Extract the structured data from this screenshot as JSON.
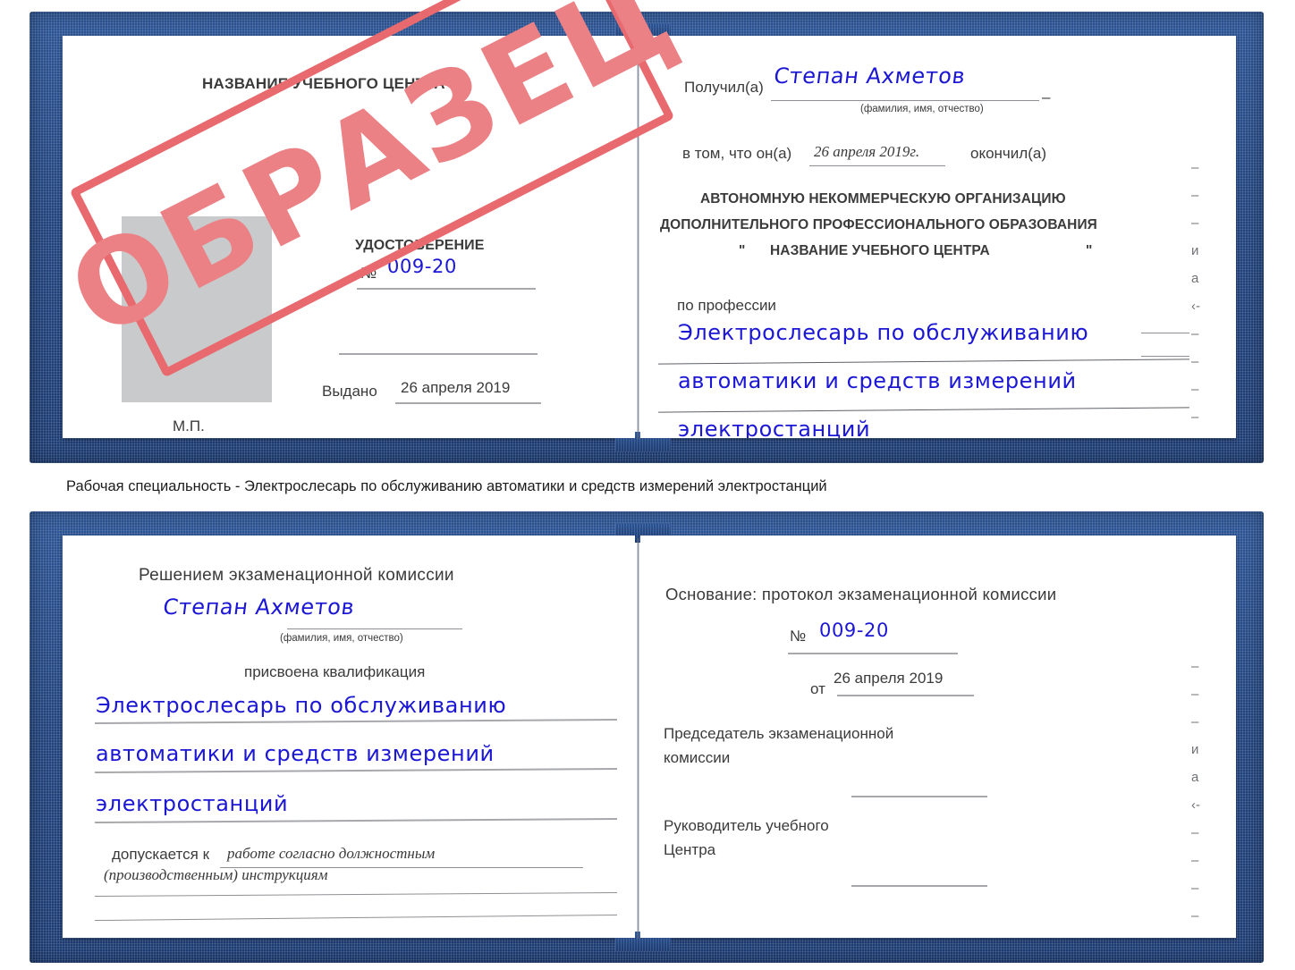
{
  "caption": {
    "text": "Рабочая специальность - Электрослесарь по обслуживанию автоматики и средств измерений электростанций"
  },
  "stamp": {
    "label": "ОБРАЗЕЦ",
    "color": "#e8696e",
    "text_color": "#eb8085"
  },
  "colors": {
    "cover_blue": "#23457f",
    "ink_blue": "#1b17d4",
    "rule_gray": "#a6a8ab",
    "photo_gray": "#c9cacb"
  },
  "certificate_front": {
    "left_page": {
      "center_name": "НАЗВАНИЕ УЧЕБНОГО ЦЕНТРА",
      "doc_type": "УДОСТОВЕРЕНИЕ",
      "number_label": "№",
      "number_value": "009-20",
      "issued_label": "Выдано",
      "issued_value": "26 апреля 2019",
      "seal_label": "М.П.",
      "photo_placeholder": ""
    },
    "right_page": {
      "received_label": "Получил(а)",
      "received_value": "Степан Ахметов",
      "received_hint": "(фамилия, имя, отчество)",
      "in_that_label": "в том, что он(а)",
      "in_that_value": "26 апреля 2019г.",
      "graduated_label": "окончил(а)",
      "org_line1": "АВТОНОМНУЮ НЕКОММЕРЧЕСКУЮ ОРГАНИЗАЦИЮ",
      "org_line2": "ДОПОЛНИТЕЛЬНОГО ПРОФЕССИОНАЛЬНОГО ОБРАЗОВАНИЯ",
      "org_quote_open": "\"",
      "org_line3": "НАЗВАНИЕ УЧЕБНОГО ЦЕНТРА",
      "org_quote_close": "\"",
      "profession_label": "по профессии",
      "profession_line1": "Электрослесарь по обслуживанию",
      "profession_line2": "автоматики и средств измерений",
      "profession_line3": "электростанций",
      "edge_bleed": [
        "–",
        "–",
        "–",
        "и",
        "а",
        "‹-",
        "–",
        "–",
        "–",
        "–"
      ]
    }
  },
  "certificate_back": {
    "left_page": {
      "heading": "Решением экзаменационной комиссии",
      "name_value": "Степан Ахметов",
      "name_hint": "(фамилия, имя, отчество)",
      "qualification_label": "присвоена квалификация",
      "qualification_line1": "Электрослесарь по обслуживанию",
      "qualification_line2": "автоматики и средств измерений",
      "qualification_line3": "электростанций",
      "admitted_label": "допускается к",
      "admitted_value1": "работе согласно должностным",
      "admitted_value2": "(производственным) инструкциям"
    },
    "right_page": {
      "basis_label": "Основание: протокол экзаменационной комиссии",
      "number_label": "№",
      "number_value": "009-20",
      "date_label": "от",
      "date_value": "26 апреля 2019",
      "chairman_line1": "Председатель экзаменационной",
      "chairman_line2": "комиссии",
      "head_line1": "Руководитель учебного",
      "head_line2": "Центра",
      "edge_bleed": [
        "–",
        "–",
        "–",
        "и",
        "а",
        "‹-",
        "–",
        "–",
        "–",
        "–"
      ]
    }
  }
}
